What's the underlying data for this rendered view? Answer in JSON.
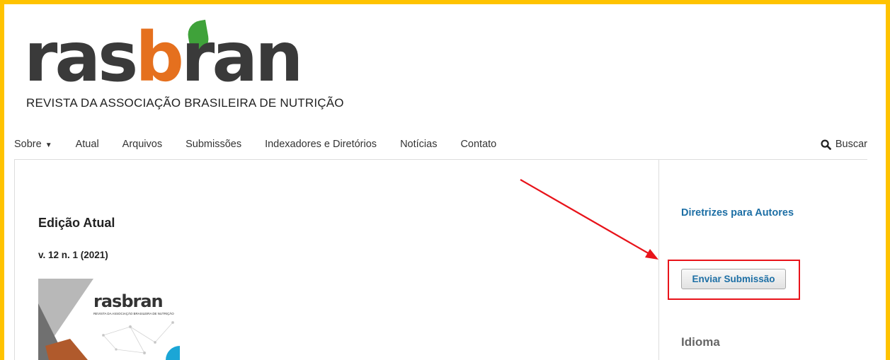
{
  "header": {
    "logo_text_pre": "ras",
    "logo_text_o": "b",
    "logo_text_post": "ran",
    "tagline": "REVISTA DA ASSOCIAÇÃO BRASILEIRA DE NUTRIÇÃO"
  },
  "nav": {
    "items": [
      "Sobre",
      "Atual",
      "Arquivos",
      "Submissões",
      "Indexadores e Diretórios",
      "Notícias",
      "Contato"
    ],
    "search_label": "Buscar"
  },
  "main": {
    "heading": "Edição Atual",
    "issue": "v. 12 n. 1 (2021)",
    "cover": {
      "brand": "rasbran",
      "subtitle": "REVISTA DA ASSOCIAÇÃO BRASILEIRA DE NUTRIÇÃO"
    }
  },
  "sidebar": {
    "authors_link": "Diretrizes para Autores",
    "submit_button": "Enviar Submissão",
    "language_heading": "Idioma"
  },
  "colors": {
    "frame": "#ffc300",
    "link": "#1d6fa5",
    "annotation": "#e8131a",
    "logo_orange": "#e5701e",
    "logo_green": "#3fa23a"
  }
}
